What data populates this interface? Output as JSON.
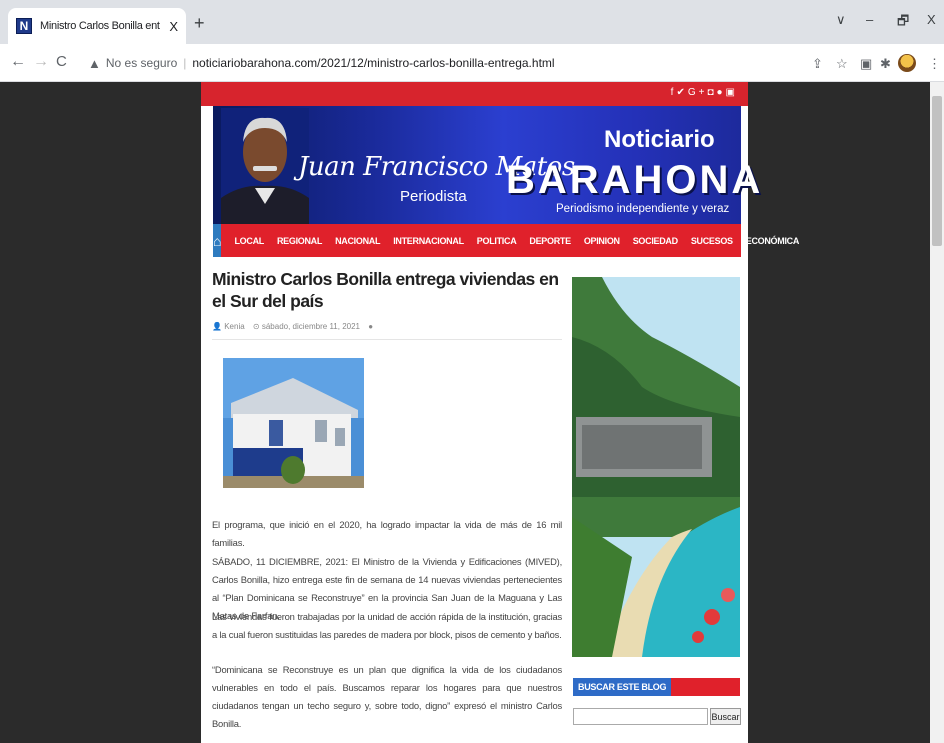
{
  "browser": {
    "tab_title": "Ministro Carlos Bonilla entrega v",
    "tab_close": "X",
    "new_tab": "+",
    "security_label": "No es seguro",
    "url": "noticiariobarahona.com/2021/12/ministro-carlos-bonilla-entrega.html",
    "window_controls": [
      "∨",
      "–",
      "🗗",
      "X"
    ]
  },
  "site": {
    "social_icons": [
      "facebook-icon",
      "twitter-icon",
      "google-plus-icon",
      "instagram-icon",
      "pinterest-icon",
      "youtube-icon"
    ],
    "header": {
      "signature": "Juan Francisco Matos",
      "signature_sub": "Periodista",
      "brand_top": "Noticiario",
      "brand_main": "BARAHONA",
      "tagline": "Periodismo independiente y veraz"
    },
    "menu": [
      "LOCAL",
      "REGIONAL",
      "NACIONAL",
      "INTERNACIONAL",
      "POLITICA",
      "DEPORTE",
      "OPINION",
      "SOCIEDAD",
      "SUCESOS",
      "ECONÓMICA"
    ],
    "article": {
      "title": "Ministro Carlos Bonilla entrega viviendas en el Sur del país",
      "author": "Kenia",
      "date": "sábado, diciembre 11, 2021",
      "paragraphs": [
        "El programa, que inició en el 2020, ha logrado impactar la vida de más de 16 mil familias.",
        "SÁBADO, 11 DICIEMBRE, 2021: El Ministro de la Vivienda y Edificaciones (MIVED), Carlos Bonilla, hizo entrega este fin de semana de 14 nuevas viviendas pertenecientes al “Plan Dominicana se Reconstruye” en la provincia San Juan de la Maguana y Las Matas de Farfan.",
        "Las viviendas fueron trabajadas por la unidad de acción rápida de la institución, gracias a la cual fueron sustituidas las paredes de madera por block, pisos de cemento y baños.",
        "“Dominicana se Reconstruye es un plan que dignifica la vida de los ciudadanos vulnerables en todo el país. Buscamos reparar los hogares para que nuestros ciudadanos tengan un techo seguro y, sobre todo, digno” expresó el ministro Carlos Bonilla."
      ]
    },
    "sidebar": {
      "widget_title": "BUSCAR ESTE BLOG",
      "search_button": "Buscar"
    }
  }
}
